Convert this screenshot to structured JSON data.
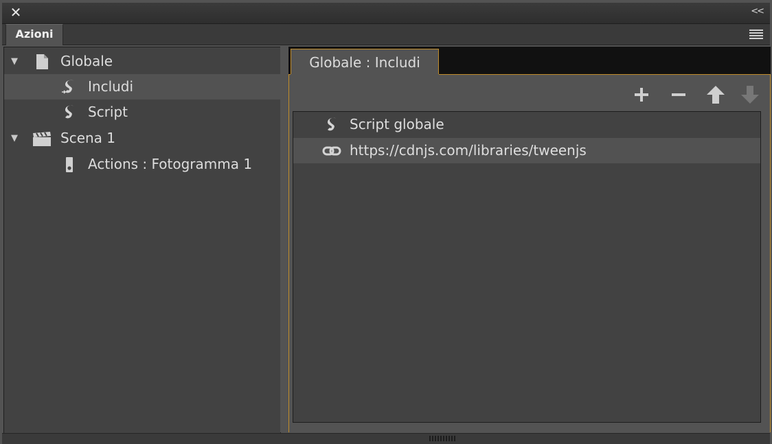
{
  "window": {
    "close_glyph": "✕",
    "collapse_glyph": "<<"
  },
  "panel_tab": {
    "label": "Azioni"
  },
  "tree": {
    "items": [
      {
        "label": "Globale",
        "icon": "document-icon",
        "expanded": true,
        "level": 0
      },
      {
        "label": "Includi",
        "icon": "include-script-icon",
        "selected": true,
        "level": 1
      },
      {
        "label": "Script",
        "icon": "script-icon",
        "level": 1
      },
      {
        "label": "Scena 1",
        "icon": "clapperboard-icon",
        "expanded": true,
        "level": 0
      },
      {
        "label": "Actions : Fotogramma 1",
        "icon": "frame-icon",
        "level": 1
      }
    ]
  },
  "editor_tab": {
    "label": "Globale : Includi"
  },
  "toolbar": {
    "add_icon": "plus-icon",
    "remove_icon": "minus-icon",
    "up_icon": "arrow-up-icon",
    "down_icon": "arrow-down-icon"
  },
  "includes": [
    {
      "label": "Script globale",
      "icon": "script-icon"
    },
    {
      "label": "https://cdnjs.com/libraries/tweenjs",
      "icon": "link-icon",
      "selected": true
    }
  ],
  "colors": {
    "accent": "#c08c2a",
    "panel_bg": "#535353",
    "list_bg": "#424242",
    "selection": "#525252"
  }
}
